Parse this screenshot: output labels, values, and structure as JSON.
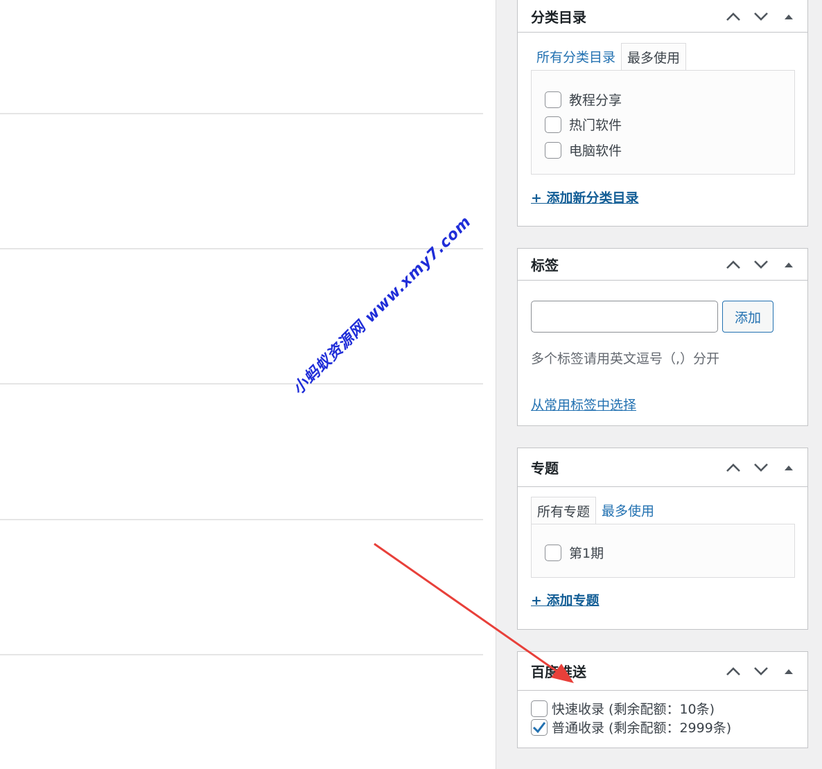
{
  "categories": {
    "title": "分类目录",
    "tabs": [
      "所有分类目录",
      "最多使用"
    ],
    "items": [
      {
        "label": "教程分享",
        "checked": false
      },
      {
        "label": "热门软件",
        "checked": false
      },
      {
        "label": "电脑软件",
        "checked": false
      }
    ],
    "add_link": "+ 添加新分类目录"
  },
  "tags": {
    "title": "标签",
    "input_value": "",
    "add_button": "添加",
    "hint": "多个标签请用英文逗号（,）分开",
    "choose_link": "从常用标签中选择"
  },
  "topics": {
    "title": "专题",
    "tabs": [
      "所有专题",
      "最多使用"
    ],
    "items": [
      {
        "label": "第1期",
        "checked": false
      }
    ],
    "add_link": "+ 添加专题"
  },
  "baidu": {
    "title": "百度推送",
    "options": [
      {
        "label": "快速收录 (剩余配额：10条)",
        "checked": false
      },
      {
        "label": "普通收录 (剩余配额：2999条)",
        "checked": true
      }
    ]
  },
  "watermark": "小蚂蚁资源网 www.xmy7.com",
  "colors": {
    "link": "#2271b1",
    "watermark": "#1f2dd8",
    "arrow": "#e8403a",
    "checkmark": "#2271b1"
  }
}
